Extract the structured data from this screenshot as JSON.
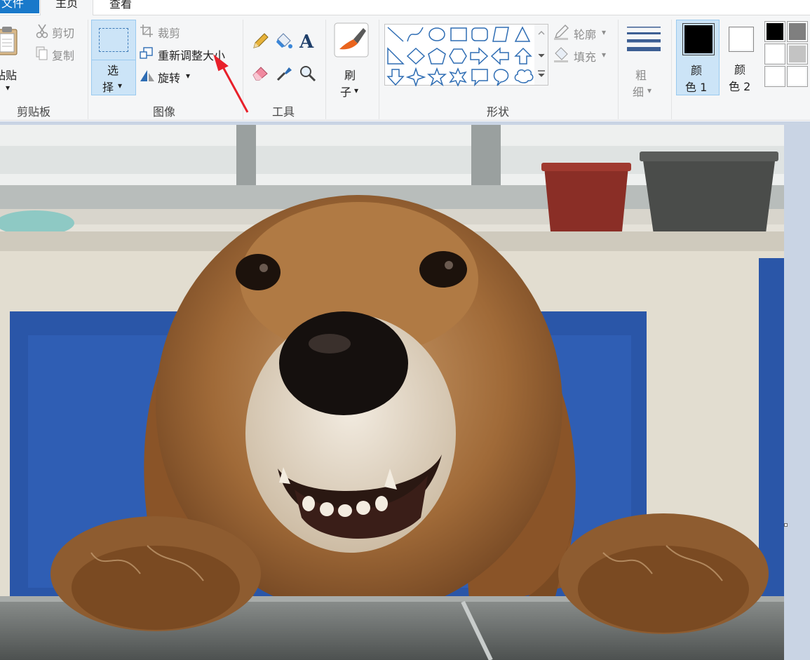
{
  "tabs": {
    "file": "文件",
    "home": "主页",
    "view": "查看"
  },
  "clipboard": {
    "paste_line1": "粘贴",
    "paste_arrow": "▾",
    "cut": "剪切",
    "copy": "复制",
    "group_label": "剪贴板"
  },
  "image": {
    "select_line1": "选",
    "select_line2": "择",
    "select_arrow": "▾",
    "crop": "裁剪",
    "resize": "重新调整大小",
    "rotate": "旋转",
    "rotate_arrow": "▾",
    "group_label": "图像"
  },
  "tools": {
    "group_label": "工具",
    "text_glyph": "A"
  },
  "brushes": {
    "line1": "刷",
    "line2": "子",
    "arrow": "▾"
  },
  "shapes": {
    "outline": "轮廓",
    "fill": "填充",
    "arrow": "▾",
    "group_label": "形状"
  },
  "size": {
    "line1": "粗",
    "line2": "细",
    "arrow": "▾"
  },
  "colors": {
    "color1_line1": "颜",
    "color1_line2": "色 1",
    "color2_line1": "颜",
    "color2_line2": "色 2",
    "color1_value": "#000000",
    "color2_value": "#ffffff",
    "palette": [
      "#000000",
      "#7f7f7f",
      "#ffffff",
      "#c3c3c3",
      "#ffffff",
      "#ffffff"
    ]
  },
  "accent": {
    "select_bg": "#cce4f7",
    "file_tab_bg": "#1979ca",
    "annotation_arrow": "#e8202a"
  }
}
